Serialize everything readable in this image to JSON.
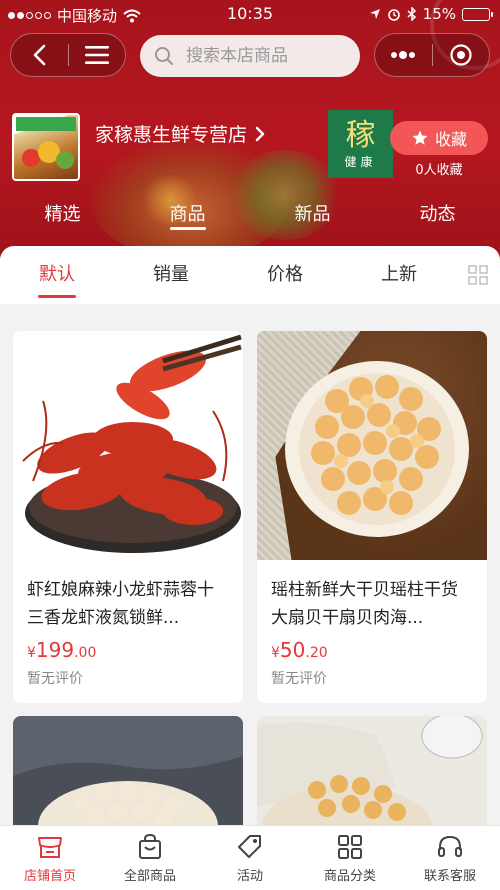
{
  "status_bar": {
    "carrier": "中国移动",
    "time": "10:35",
    "battery": "15%",
    "battery_level": 0.15
  },
  "nav": {
    "back_icon": "back-icon",
    "menu_icon": "menu-icon",
    "more_icon": "more-icon",
    "close_icon": "capsule-close-icon"
  },
  "search": {
    "placeholder": "搜索本店商品"
  },
  "store": {
    "name": "家稼惠生鲜专营店",
    "brand_logo_text": "稼",
    "brand_logo_sub": "健康",
    "favorite_label": "收藏",
    "favorite_count": "0人收藏"
  },
  "store_tabs": [
    {
      "label": "精选",
      "active": false
    },
    {
      "label": "商品",
      "active": true
    },
    {
      "label": "新品",
      "active": false
    },
    {
      "label": "动态",
      "active": false
    }
  ],
  "sort_tabs": [
    {
      "label": "默认",
      "active": true
    },
    {
      "label": "销量",
      "active": false
    },
    {
      "label": "价格",
      "active": false
    },
    {
      "label": "上新",
      "active": false
    }
  ],
  "products": [
    {
      "title": "虾红娘麻辣小龙虾蒜蓉十三香龙虾液氮锁鲜...",
      "price_symbol": "¥",
      "price_int": "199",
      "price_dec": ".00",
      "review": "暂无评价"
    },
    {
      "title": "瑶柱新鲜大干贝瑶柱干货大扇贝干扇贝肉海...",
      "price_symbol": "¥",
      "price_int": "50",
      "price_dec": ".20",
      "review": "暂无评价"
    }
  ],
  "tabbar": [
    {
      "label": "店铺首页",
      "icon": "store-icon",
      "active": true
    },
    {
      "label": "全部商品",
      "icon": "shopping-bag-icon",
      "active": false
    },
    {
      "label": "活动",
      "icon": "tag-icon",
      "active": false
    },
    {
      "label": "商品分类",
      "icon": "category-grid-icon",
      "active": false
    },
    {
      "label": "联系客服",
      "icon": "headset-icon",
      "active": false
    }
  ],
  "colors": {
    "header_red": "#a8141c",
    "accent_red": "#e4393c",
    "favorite_button": "#f25656"
  }
}
